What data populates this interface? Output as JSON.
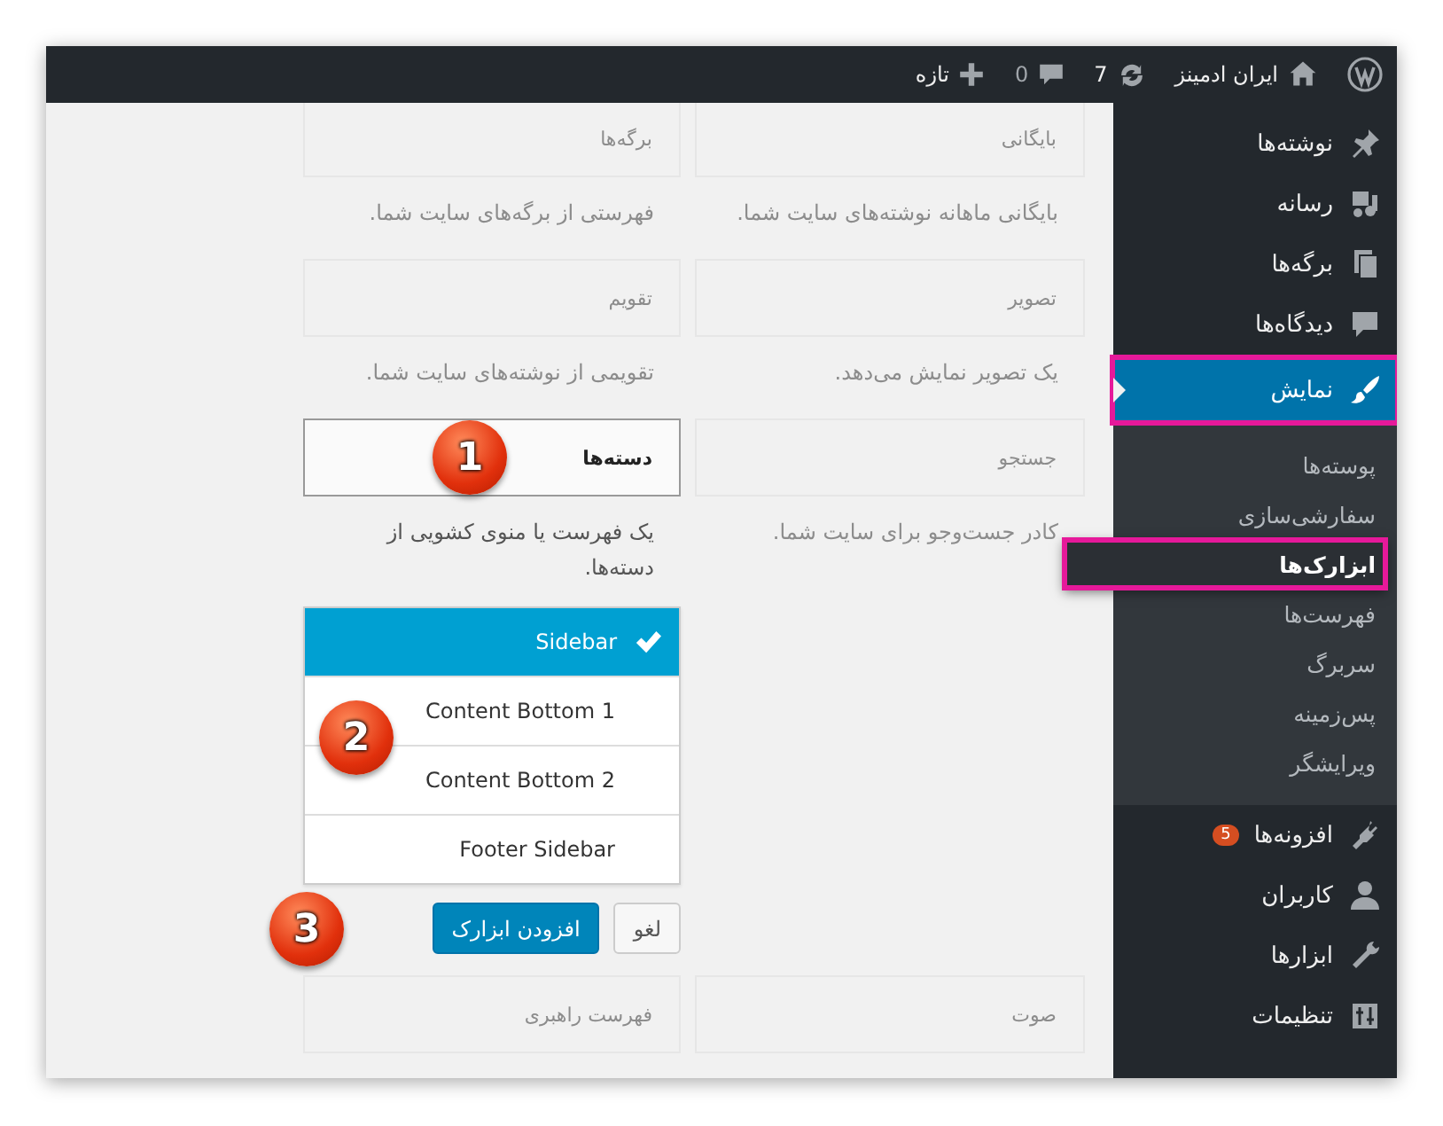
{
  "admin_bar": {
    "site_name": "ایران ادمینز",
    "updates": "7",
    "comments": "0",
    "new_label": "تازه"
  },
  "menu": [
    {
      "label": "نوشته‌ها",
      "selected": false,
      "highlighted": false
    },
    {
      "label": "رسانه",
      "selected": false,
      "highlighted": false
    },
    {
      "label": "برگه‌ها",
      "selected": false,
      "highlighted": false
    },
    {
      "label": "دیدگاه‌ها",
      "selected": false,
      "highlighted": false
    },
    {
      "label": "نمایش",
      "selected": true,
      "highlighted": true,
      "children": [
        {
          "label": "پوسته‌ها",
          "selected": false,
          "highlighted": false
        },
        {
          "label": "سفارشی‌سازی",
          "selected": false,
          "highlighted": false
        },
        {
          "label": "ابزارک‌ها",
          "selected": true,
          "highlighted": true
        },
        {
          "label": "فهرست‌ها",
          "selected": false,
          "highlighted": false
        },
        {
          "label": "سربرگ",
          "selected": false,
          "highlighted": false
        },
        {
          "label": "پس‌زمینه",
          "selected": false,
          "highlighted": false
        },
        {
          "label": "ویرایشگر",
          "selected": false,
          "highlighted": false
        }
      ]
    },
    {
      "label": "افزونه‌ها",
      "selected": false,
      "highlighted": false,
      "badge": "5"
    },
    {
      "label": "کاربران",
      "selected": false,
      "highlighted": false
    },
    {
      "label": "ابزارها",
      "selected": false,
      "highlighted": false
    },
    {
      "label": "تنظیمات",
      "selected": false,
      "highlighted": false
    }
  ],
  "widget_rows": [
    {
      "widgets": [
        {
          "title": "بایگانی",
          "description": "بایگانی ماهانه نوشته‌های سایت شما.",
          "expanded": false
        },
        {
          "title": "برگه‌ها",
          "description": "فهرستی از برگه‌های سایت شما.",
          "expanded": false
        }
      ]
    },
    {
      "widgets": [
        {
          "title": "تصویر",
          "description": "یک تصویر نمایش می‌دهد.",
          "expanded": false
        },
        {
          "title": "تقویم",
          "description": "تقویمی از نوشته‌های سایت شما.",
          "expanded": false
        }
      ]
    },
    {
      "widgets": [
        {
          "title": "جستجو",
          "description": "کادر جست‌وجو برای سایت شما.",
          "expanded": false
        },
        {
          "title": "دسته‌ها",
          "description": "یک فهرست یا منوی کشویی از دسته‌ها.",
          "expanded": true,
          "callout": "1",
          "sidebars": [
            {
              "label": "Sidebar",
              "selected": true
            },
            {
              "label": "Content Bottom 1",
              "selected": false
            },
            {
              "label": "Content Bottom 2",
              "selected": false
            },
            {
              "label": "Footer Sidebar",
              "selected": false
            }
          ],
          "sidebars_callout": "2",
          "buttons_callout": "3",
          "cancel_label": "لغو",
          "add_label": "افزودن ابزارک"
        }
      ]
    },
    {
      "widgets": [
        {
          "title": "صوت",
          "expanded": false
        },
        {
          "title": "فهرست راهبری",
          "expanded": false
        }
      ]
    }
  ]
}
